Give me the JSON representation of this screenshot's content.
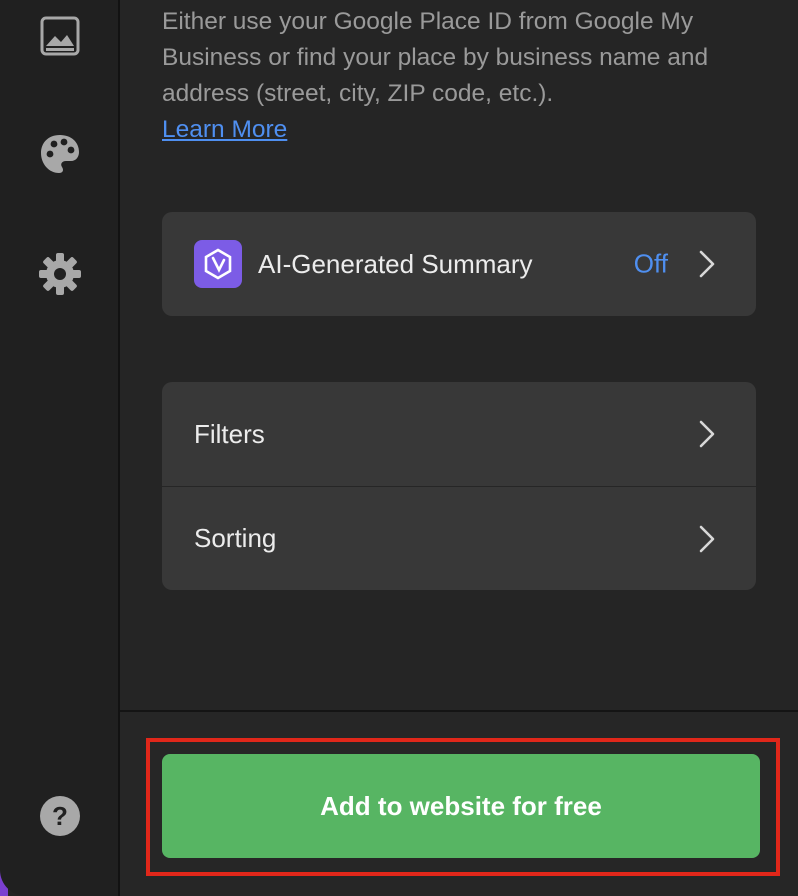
{
  "colors": {
    "accent_link": "#4f8ff0",
    "cta_green": "#57b563",
    "highlight_red": "#e0271a",
    "ai_icon_purple": "#7c5ce6",
    "sidebar_edge_purple": "#7b3fd0"
  },
  "sidebar": {
    "items": [
      {
        "icon": "image-icon"
      },
      {
        "icon": "palette-icon"
      },
      {
        "icon": "gear-icon"
      },
      {
        "icon": "help-icon",
        "glyph": "?"
      }
    ]
  },
  "main": {
    "description": "Either use your Google Place ID from Google My Business or find your place by business name and address (street, city, ZIP code, etc.).",
    "learn_more": "Learn More",
    "ai_summary": {
      "icon": "ai-hexagon-icon",
      "label": "AI-Generated Summary",
      "status": "Off"
    },
    "settings_rows": [
      {
        "label": "Filters"
      },
      {
        "label": "Sorting"
      }
    ]
  },
  "footer": {
    "cta_label": "Add to website for free"
  }
}
